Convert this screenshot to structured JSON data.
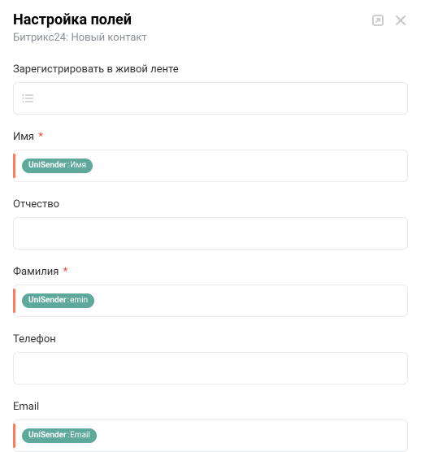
{
  "header": {
    "title": "Настройка полей",
    "subtitle": "Битрикс24: Новый контакт"
  },
  "fields": {
    "feed": {
      "label": "Зарегистрировать в живой ленте"
    },
    "firstName": {
      "label": "Имя",
      "required": "*",
      "tagSource": "UniSender",
      "tagName": "Имя"
    },
    "middleName": {
      "label": "Отчество"
    },
    "lastName": {
      "label": "Фамилия",
      "required": "*",
      "tagSource": "UniSender",
      "tagName": "emin"
    },
    "phone": {
      "label": "Телефон"
    },
    "email": {
      "label": "Email",
      "tagSource": "UniSender",
      "tagName": "Email"
    }
  },
  "tagSeparator": ": "
}
